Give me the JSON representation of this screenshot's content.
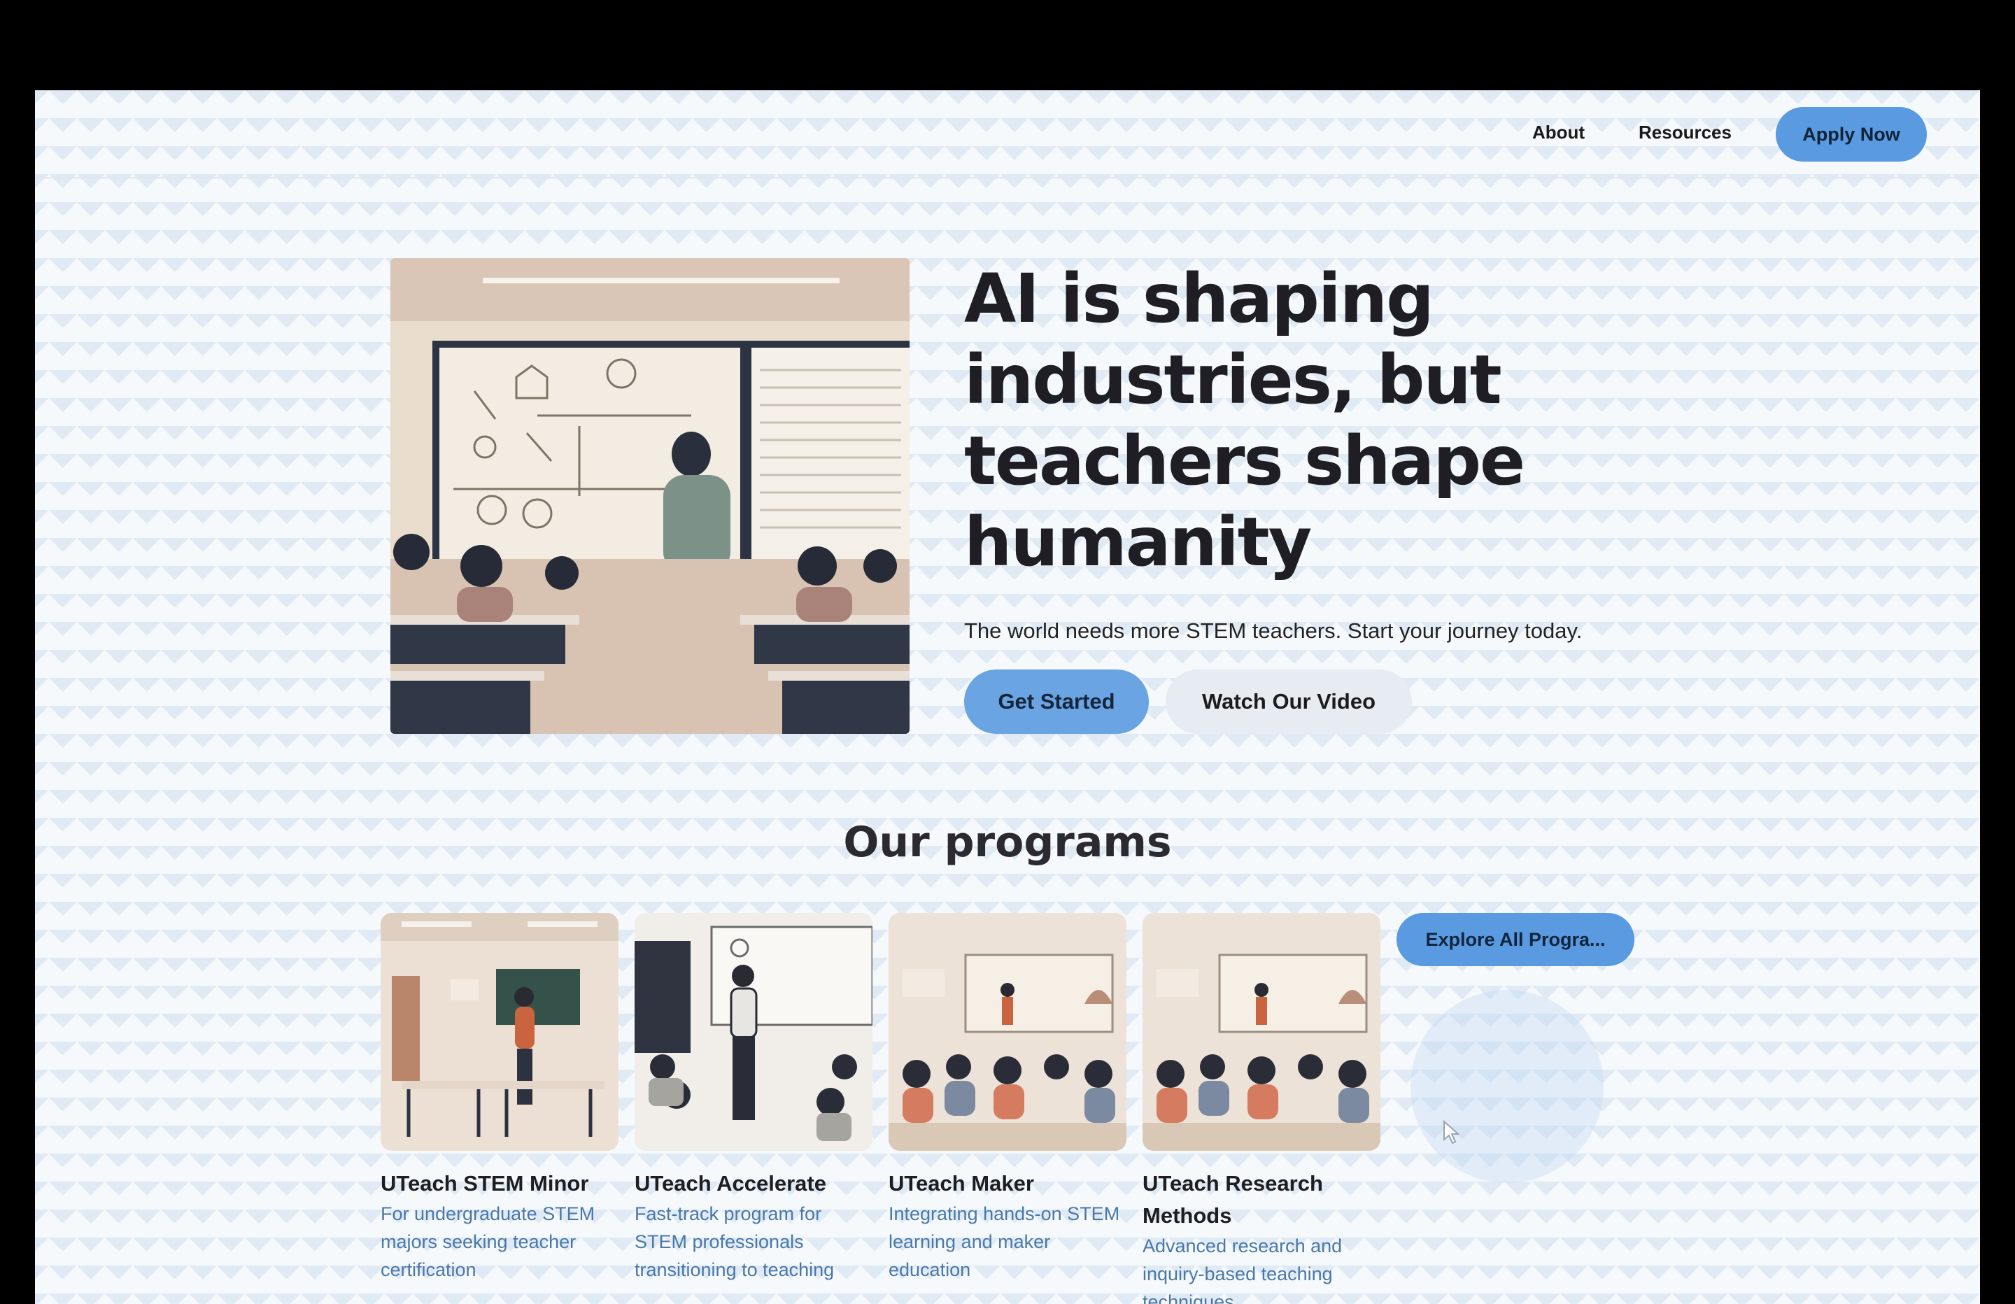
{
  "nav": {
    "links": [
      "About",
      "Resources"
    ],
    "apply_label": "Apply Now"
  },
  "hero": {
    "title": "AI is shaping industries, but teachers shape humanity",
    "subtitle": "The world needs more STEM teachers. Start your journey today.",
    "primary_label": "Get Started",
    "secondary_label": "Watch Our Video"
  },
  "programs": {
    "title": "Our programs",
    "items": [
      {
        "title": "UTeach STEM Minor",
        "desc": "For undergraduate STEM majors seeking teacher certification"
      },
      {
        "title": "UTeach Accelerate",
        "desc": "Fast-track program for STEM professionals transitioning to teaching"
      },
      {
        "title": "UTeach Maker",
        "desc": "Integrating hands-on STEM learning and maker education"
      },
      {
        "title": "UTeach Research Methods",
        "desc": "Advanced research and inquiry-based teaching techniques"
      }
    ],
    "explore_label": "Explore All Progra..."
  },
  "colors": {
    "accent": "#5a9ae0",
    "page_bg": "#f6f9fc",
    "desc_text": "#4a78a8"
  }
}
